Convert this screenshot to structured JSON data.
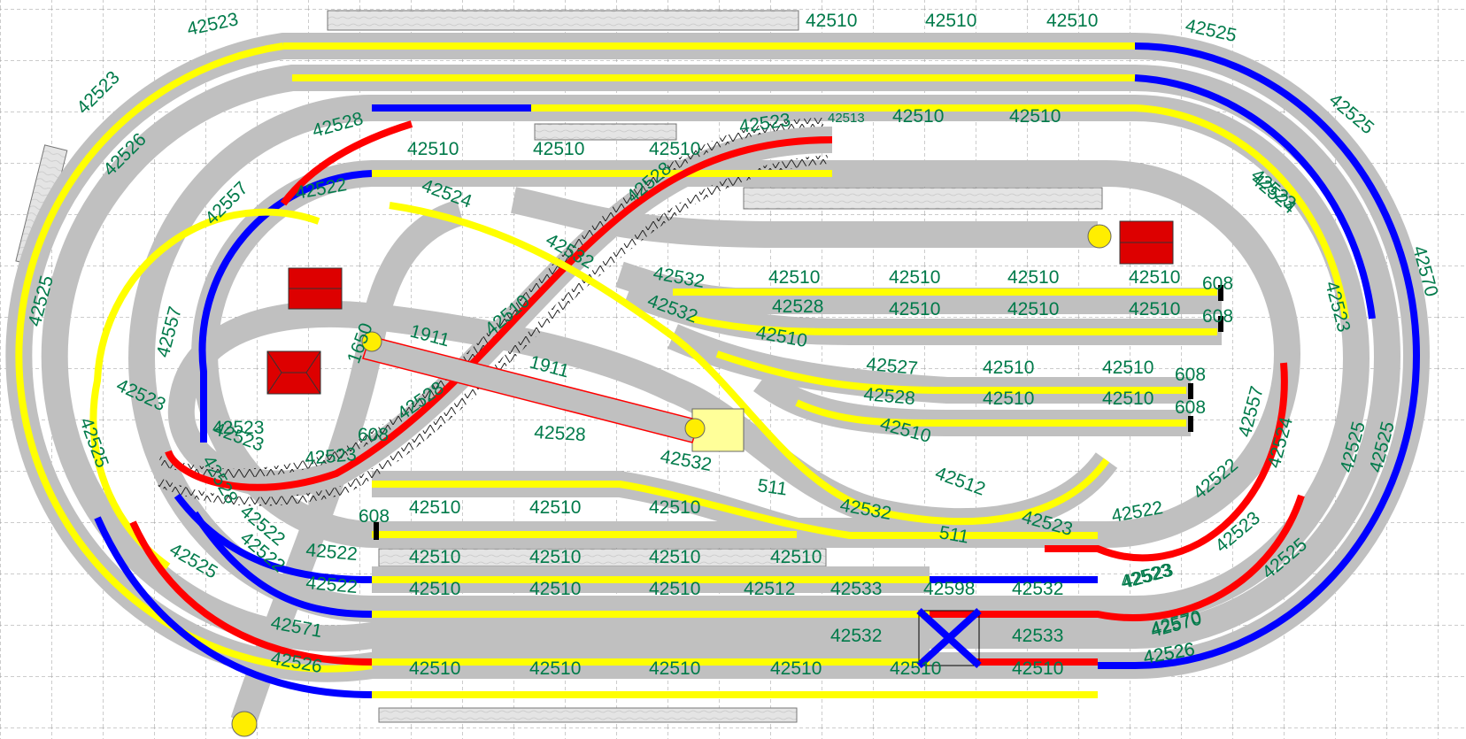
{
  "colors": {
    "background": "#ffffff",
    "grid": "#9a9a9a",
    "bed": "#c0c0c0",
    "bed_edge": "#6e6e6e",
    "yellow": "#ffff00",
    "blue": "#0000ff",
    "red": "#ff0000",
    "label": "#007a4a",
    "platform": "#e2e2e2",
    "building": "#dd0000",
    "buffer": "#ffee00"
  },
  "labels": {
    "top_l1": "42523",
    "top_l2": "42510",
    "top_l3": "42510",
    "top_l4": "42510",
    "top_r1": "42525",
    "top_r2": "42525",
    "l_1": "42523",
    "l_2": "42526",
    "l_3": "42528",
    "l_4": "42557",
    "l_5": "42522",
    "l_6": "42525",
    "l_7": "42557",
    "l_8": "42523",
    "l_9": "42525",
    "l_10": "42524",
    "l_11": "1650",
    "mid_1": "42510",
    "mid_2": "42510",
    "mid_3": "42510",
    "mid_4": "42523",
    "mid_5": "42510",
    "mid_6": "42510",
    "mid_7": "42513",
    "mid_8": "42528",
    "mid_9": "42524",
    "mid_10": "42532",
    "c_1": "1911",
    "c_2": "1911",
    "c_3": "42532",
    "c_4": "42532",
    "c_5": "42510",
    "c_6": "42528",
    "c_7": "42510",
    "s1_1": "42510",
    "s1_2": "42510",
    "s1_3": "42510",
    "s1_4": "42510",
    "s1_5": "608",
    "s2_1": "42528",
    "s2_2": "42510",
    "s2_3": "42510",
    "s2_4": "42510",
    "s2_5": "608",
    "s3_1": "42527",
    "s3_2": "42510",
    "s3_3": "42510",
    "s3_4": "608",
    "s4_1": "42528",
    "s4_2": "42510",
    "s4_3": "42510",
    "s4_4": "608",
    "s5_1": "42510",
    "r_1": "42523",
    "r_2": "42523",
    "r_3": "42570",
    "r_4": "42557",
    "r_5": "42524",
    "r_6": "42525",
    "r_7": "42525",
    "r_8": "42525",
    "r_9": "42522",
    "r_10": "42523",
    "r_11": "42523",
    "r_12": "42570",
    "r_13": "42526",
    "b_1": "42523",
    "b_2": "42528",
    "b_3": "42532",
    "b_4": "511",
    "b_5": "42532",
    "b_6": "42512",
    "b_7": "511",
    "b_8": "42523",
    "b_9": "42522",
    "b_10": "608",
    "b_11": "42510",
    "b_12": "42510",
    "b_13": "42510",
    "b_14": "42510",
    "b_15": "42510",
    "b_16": "42510",
    "b_17": "42510",
    "b_18": "42510",
    "b_19": "42510",
    "b_20": "42510",
    "b_21": "42512",
    "b_22": "42533",
    "b_23": "42598",
    "b_24": "42532",
    "b_25": "42523",
    "b_26": "42532",
    "b_27": "42533",
    "b_28": "42570",
    "b_29": "42510",
    "b_30": "42510",
    "b_31": "42510",
    "b_32": "42510",
    "b_33": "42510",
    "b_34": "42510",
    "b_35": "42526",
    "bl_1": "42525",
    "bl_2": "42522",
    "bl_3": "42522",
    "bl_4": "42571",
    "bl_5": "42526",
    "bl_6": "42522",
    "bl_7": "42523",
    "bl_8": "42522",
    "bl_9": "42528",
    "bl_10": "42523",
    "bl_11": "608"
  }
}
